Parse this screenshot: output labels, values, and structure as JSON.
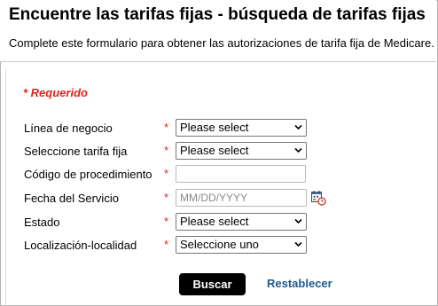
{
  "header": {
    "title": "Encuentre las tarifas fijas - búsqueda de tarifas fijas",
    "subtitle": "Complete este formulario para obtener las autorizaciones de tarifa fija de Medicare."
  },
  "form": {
    "required_note": "* Requerido",
    "required_marker": "*",
    "fields": {
      "line_of_business": {
        "label": "Línea de negocio",
        "value": "Please select"
      },
      "fee_schedule": {
        "label": "Seleccione tarifa fija",
        "value": "Please select"
      },
      "procedure_code": {
        "label": "Código de procedimiento",
        "value": "",
        "placeholder": ""
      },
      "service_date": {
        "label": "Fecha del Servicio",
        "value": "",
        "placeholder": "MM/DD/YYYY",
        "icon": "calendar-clock-icon"
      },
      "state": {
        "label": "Estado",
        "value": "Please select"
      },
      "locality": {
        "label": "Localización-localidad",
        "value": "Seleccione uno"
      }
    },
    "search_button_label": "Buscar",
    "reset_link_label": "Restablecer"
  },
  "colors": {
    "required_red": "#e0231c",
    "button_bg": "#000000",
    "link_blue": "#1f5a8a"
  }
}
